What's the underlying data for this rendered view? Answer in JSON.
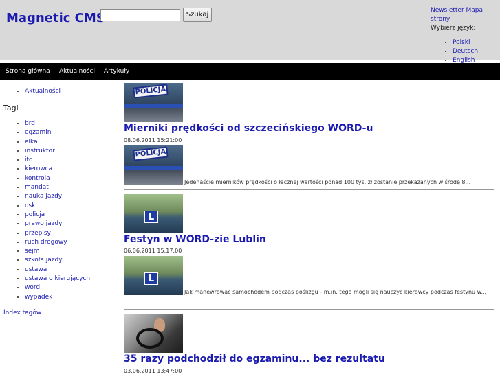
{
  "header": {
    "site_title": "Magnetic CMS",
    "search": {
      "placeholder": "",
      "value": "",
      "button_label": "Szukaj"
    },
    "newsletter_link": "Newsletter",
    "sitemap_link": "Mapa strony",
    "choose_language_label": "Wybierz język:",
    "languages": [
      "Polski",
      "Deutsch",
      "English"
    ]
  },
  "nav": {
    "items": [
      "Strona główna",
      "Aktualności",
      "Artykuły"
    ]
  },
  "sidebar": {
    "categories": [
      "Aktualności"
    ],
    "tags_heading": "Tagi",
    "tags": [
      "brd",
      "egzamin",
      "elka",
      "instruktor",
      "itd",
      "kierowca",
      "kontrola",
      "mandat",
      "nauka jazdy",
      "osk",
      "policja",
      "prawo jazdy",
      "przepisy",
      "ruch drogowy",
      "sejm",
      "szkoła jazdy",
      "ustawa",
      "ustawa o kierujących",
      "word",
      "wypadek"
    ],
    "tag_index_link": "Index tagów"
  },
  "articles": [
    {
      "title": "Mierniki prędkości od szczecińskiego WORD-u",
      "date": "08.06.2011 15:21:00",
      "lead": "Jedenaście mierników prędkości o łącznej wartości ponad 100 tys. zł zostanie przekazanych w środę 8...",
      "thumb_text": "POLICJA"
    },
    {
      "title": "Festyn w WORD-zie Lublin",
      "date": "06.06.2011 15:17:00",
      "lead": "Jak manewrować samochodem podczas poślizgu - m.in. tego mogli się nauczyć kierowcy podczas festynu w...",
      "thumb_text": "L"
    },
    {
      "title": "35 razy podchodził do egzaminu... bez rezultatu",
      "date": "03.06.2011 13:47:00"
    }
  ]
}
